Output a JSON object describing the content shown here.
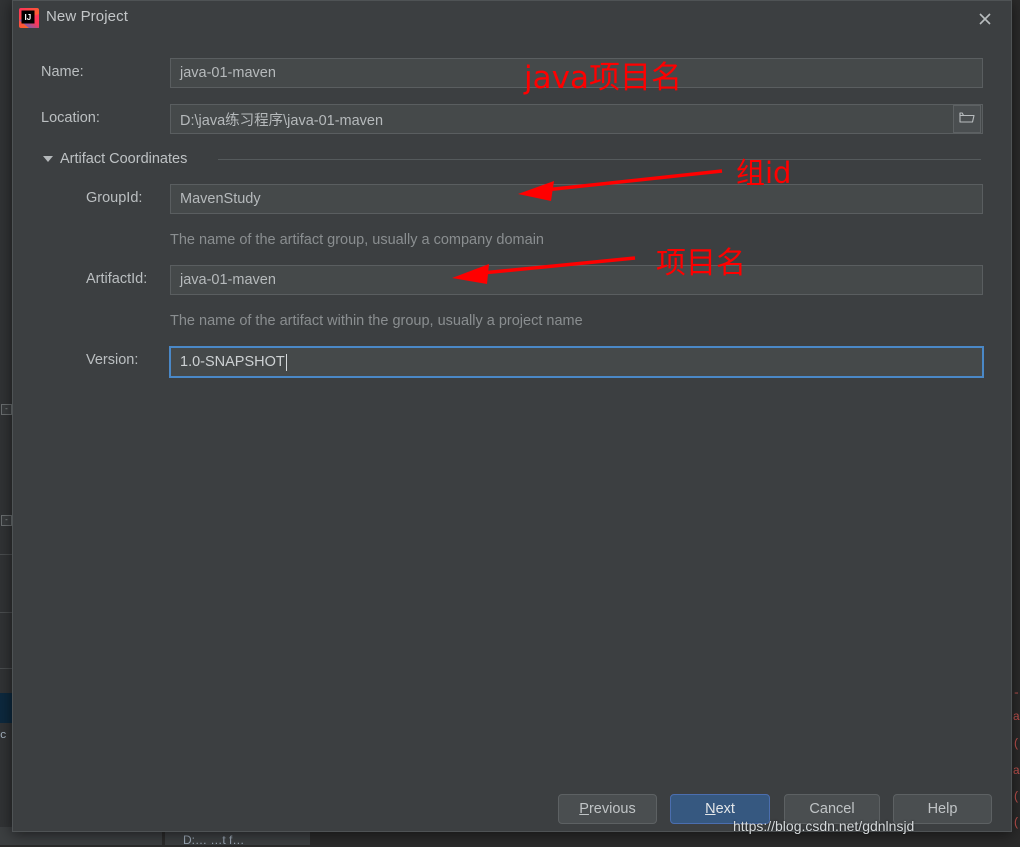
{
  "window": {
    "title": "New Project",
    "app_icon": "intellij-idea-icon",
    "close_icon": "close-icon",
    "background_color": "#3c3f41",
    "accent_color": "#4a88c7"
  },
  "form": {
    "name": {
      "label": "Name:",
      "value": "java-01-maven"
    },
    "location": {
      "label": "Location:",
      "value": "D:\\java练习程序\\java-01-maven",
      "browse_icon": "folder-icon"
    },
    "section": {
      "title": "Artifact Coordinates",
      "expanded": true,
      "collapse_icon": "triangle-down-icon"
    },
    "group_id": {
      "label": "GroupId:",
      "value": "MavenStudy",
      "hint": "The name of the artifact group, usually a company domain"
    },
    "artifact_id": {
      "label": "ArtifactId:",
      "value": "java-01-maven",
      "hint": "The name of the artifact within the group, usually a project name"
    },
    "version": {
      "label": "Version:",
      "value": "1.0-SNAPSHOT",
      "focused": true
    }
  },
  "buttons": {
    "previous": {
      "label": "Previous",
      "mnemonic": "P",
      "primary": false
    },
    "next": {
      "label": "Next",
      "mnemonic": "N",
      "primary": true
    },
    "cancel": {
      "label": "Cancel",
      "mnemonic": "",
      "primary": false
    },
    "help": {
      "label": "Help",
      "mnemonic": "",
      "primary": false
    }
  },
  "annotations": {
    "color": "#ff0000",
    "name_note": "java项目名",
    "group_note": "组id",
    "artifact_note": "项目名"
  },
  "watermark": {
    "text": "https://blog.csdn.net/gdnlnsjd"
  },
  "background_ide": {
    "code_fragments": [
      "a",
      ")(",
      "a",
      ")(",
      ")("
    ],
    "status_text": "D:…  …t  f…"
  }
}
